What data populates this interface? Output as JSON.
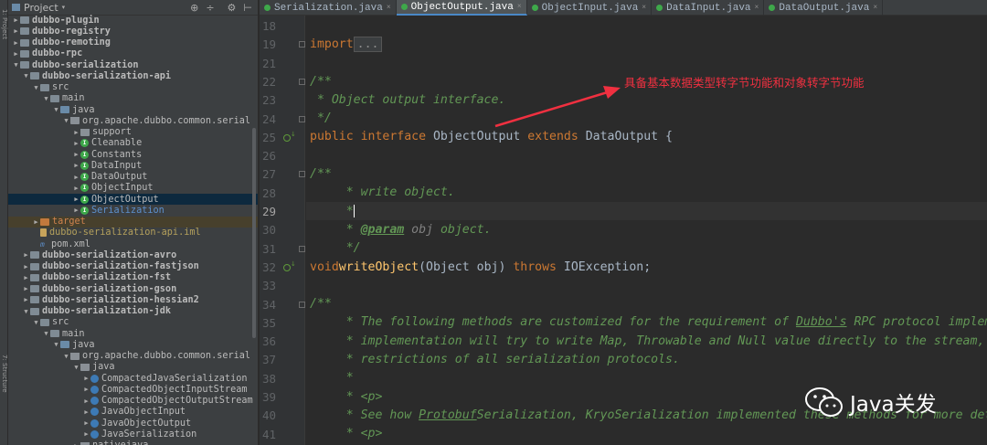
{
  "toolstrip": {
    "project_tab": "1: Project",
    "structure_tab": "7: Structure"
  },
  "project_panel": {
    "title": "Project",
    "tools": [
      "⊕",
      "÷",
      "⚙",
      "⊢"
    ],
    "tree": [
      {
        "label": "dubbo-plugin",
        "depth": 0,
        "arrow": "▶",
        "icon": "folder",
        "style": "bold"
      },
      {
        "label": "dubbo-registry",
        "depth": 0,
        "arrow": "▶",
        "icon": "folder",
        "style": "bold"
      },
      {
        "label": "dubbo-remoting",
        "depth": 0,
        "arrow": "▶",
        "icon": "folder",
        "style": "bold"
      },
      {
        "label": "dubbo-rpc",
        "depth": 0,
        "arrow": "▶",
        "icon": "folder",
        "style": "bold"
      },
      {
        "label": "dubbo-serialization",
        "depth": 0,
        "arrow": "▼",
        "icon": "folder",
        "style": "bold"
      },
      {
        "label": "dubbo-serialization-api",
        "depth": 1,
        "arrow": "▼",
        "icon": "folder",
        "style": "bold"
      },
      {
        "label": "src",
        "depth": 2,
        "arrow": "▼",
        "icon": "folder",
        "style": ""
      },
      {
        "label": "main",
        "depth": 3,
        "arrow": "▼",
        "icon": "folder",
        "style": ""
      },
      {
        "label": "java",
        "depth": 4,
        "arrow": "▼",
        "icon": "src",
        "style": ""
      },
      {
        "label": "org.apache.dubbo.common.serial",
        "depth": 5,
        "arrow": "▼",
        "icon": "pkg",
        "style": ""
      },
      {
        "label": "support",
        "depth": 6,
        "arrow": "▶",
        "icon": "pkg",
        "style": ""
      },
      {
        "label": "Cleanable",
        "depth": 6,
        "arrow": "▶",
        "icon": "cls",
        "style": ""
      },
      {
        "label": "Constants",
        "depth": 6,
        "arrow": "▶",
        "icon": "cls",
        "style": ""
      },
      {
        "label": "DataInput",
        "depth": 6,
        "arrow": "▶",
        "icon": "cls",
        "style": ""
      },
      {
        "label": "DataOutput",
        "depth": 6,
        "arrow": "▶",
        "icon": "cls",
        "style": ""
      },
      {
        "label": "ObjectInput",
        "depth": 6,
        "arrow": "▶",
        "icon": "cls",
        "style": ""
      },
      {
        "label": "ObjectOutput",
        "depth": 6,
        "arrow": "▶",
        "icon": "cls",
        "style": "selected"
      },
      {
        "label": "Serialization",
        "depth": 6,
        "arrow": "▶",
        "icon": "cls",
        "style": "blue"
      },
      {
        "label": "target",
        "depth": 2,
        "arrow": "▶",
        "icon": "orange",
        "style": "orange"
      },
      {
        "label": "dubbo-serialization-api.iml",
        "depth": 2,
        "arrow": "",
        "icon": "file",
        "style": "yel"
      },
      {
        "label": "pom.xml",
        "depth": 2,
        "arrow": "",
        "icon": "m",
        "style": ""
      },
      {
        "label": "dubbo-serialization-avro",
        "depth": 1,
        "arrow": "▶",
        "icon": "folder",
        "style": "bold"
      },
      {
        "label": "dubbo-serialization-fastjson",
        "depth": 1,
        "arrow": "▶",
        "icon": "folder",
        "style": "bold"
      },
      {
        "label": "dubbo-serialization-fst",
        "depth": 1,
        "arrow": "▶",
        "icon": "folder",
        "style": "bold"
      },
      {
        "label": "dubbo-serialization-gson",
        "depth": 1,
        "arrow": "▶",
        "icon": "folder",
        "style": "bold"
      },
      {
        "label": "dubbo-serialization-hessian2",
        "depth": 1,
        "arrow": "▶",
        "icon": "folder",
        "style": "bold"
      },
      {
        "label": "dubbo-serialization-jdk",
        "depth": 1,
        "arrow": "▼",
        "icon": "folder",
        "style": "bold"
      },
      {
        "label": "src",
        "depth": 2,
        "arrow": "▼",
        "icon": "folder",
        "style": ""
      },
      {
        "label": "main",
        "depth": 3,
        "arrow": "▼",
        "icon": "folder",
        "style": ""
      },
      {
        "label": "java",
        "depth": 4,
        "arrow": "▼",
        "icon": "src",
        "style": ""
      },
      {
        "label": "org.apache.dubbo.common.serial",
        "depth": 5,
        "arrow": "▼",
        "icon": "pkg",
        "style": ""
      },
      {
        "label": "java",
        "depth": 6,
        "arrow": "▼",
        "icon": "pkg",
        "style": ""
      },
      {
        "label": "CompactedJavaSerialization",
        "depth": 7,
        "arrow": "▶",
        "icon": "clsb",
        "style": ""
      },
      {
        "label": "CompactedObjectInputStream",
        "depth": 7,
        "arrow": "▶",
        "icon": "clsb",
        "style": ""
      },
      {
        "label": "CompactedObjectOutputStream",
        "depth": 7,
        "arrow": "▶",
        "icon": "clsb",
        "style": ""
      },
      {
        "label": "JavaObjectInput",
        "depth": 7,
        "arrow": "▶",
        "icon": "clsb",
        "style": ""
      },
      {
        "label": "JavaObjectOutput",
        "depth": 7,
        "arrow": "▶",
        "icon": "clsb",
        "style": ""
      },
      {
        "label": "JavaSerialization",
        "depth": 7,
        "arrow": "▶",
        "icon": "clsb",
        "style": ""
      },
      {
        "label": "nativejava",
        "depth": 6,
        "arrow": "▶",
        "icon": "pkg",
        "style": ""
      }
    ]
  },
  "tabs": [
    {
      "label": "Serialization.java",
      "active": false,
      "icon": "g"
    },
    {
      "label": "ObjectOutput.java",
      "active": true,
      "icon": "g"
    },
    {
      "label": "ObjectInput.java",
      "active": false,
      "icon": "g"
    },
    {
      "label": "DataInput.java",
      "active": false,
      "icon": "g"
    },
    {
      "label": "DataOutput.java",
      "active": false,
      "icon": "g"
    }
  ],
  "editor": {
    "current_line": 29,
    "lines": [
      {
        "n": "18",
        "html": ""
      },
      {
        "n": "19",
        "html": "<span class=\"kw\">import</span> <span class=\"fold-box\">...</span>"
      },
      {
        "n": "21",
        "html": ""
      },
      {
        "n": "22",
        "html": "<span class=\"cm\">/**</span>"
      },
      {
        "n": "23",
        "html": "<span class=\"cm\"> * Object output interface.</span>"
      },
      {
        "n": "24",
        "html": "<span class=\"cm\"> */</span>"
      },
      {
        "n": "25",
        "html": "<span class=\"kw\">public interface</span> ObjectOutput <span class=\"kw\">extends</span> DataOutput {"
      },
      {
        "n": "26",
        "html": ""
      },
      {
        "n": "27",
        "html": "    <span class=\"cm\">/**</span>"
      },
      {
        "n": "28",
        "html": "<span class=\"cm\">     * write object.</span>"
      },
      {
        "n": "29",
        "html": "<span class=\"cm\">     *</span><span class=\"caret\"></span>"
      },
      {
        "n": "30",
        "html": "<span class=\"cm\">     * </span><span class=\"tag\">@param</span><span class=\"cm\"> </span><span class=\"cmt\" style=\"font-style:italic\">obj</span><span class=\"cm\"> object.</span>"
      },
      {
        "n": "31",
        "html": "<span class=\"cm\">     */</span>"
      },
      {
        "n": "32",
        "html": "    <span class=\"kw\">void</span> <span class=\"fn\">writeObject</span>(Object obj) <span class=\"kw\">throws</span> IOException;"
      },
      {
        "n": "33",
        "html": ""
      },
      {
        "n": "34",
        "html": "    <span class=\"cm\">/**</span>"
      },
      {
        "n": "35",
        "html": "<span class=\"cm\">     * The following methods are customized for the requirement of </span><span class=\"cm under\">Dubbo's</span><span class=\"cm\"> RPC protocol implementation.</span>"
      },
      {
        "n": "36",
        "html": "<span class=\"cm\">     * implementation will try to write Map, Throwable and Null value directly to the stream, which</span>"
      },
      {
        "n": "37",
        "html": "<span class=\"cm\">     * restrictions of all serialization protocols.</span>"
      },
      {
        "n": "38",
        "html": "<span class=\"cm\">     *</span>"
      },
      {
        "n": "39",
        "html": "<span class=\"cm\">     * &lt;p&gt;</span>"
      },
      {
        "n": "40",
        "html": "<span class=\"cm\">     * See how </span><span class=\"cm under\">Protobuf</span><span class=\"cm\">Serialization, KryoSerialization implemented these methods for more details.</span>"
      },
      {
        "n": "41",
        "html": "<span class=\"cm\">     * &lt;p&gt;</span>"
      }
    ],
    "gutter_markers": [
      {
        "line": "25",
        "type": "implemented"
      },
      {
        "line": "32",
        "type": "implemented"
      }
    ]
  },
  "annotation": {
    "text": "具备基本数据类型转字节功能和对象转字节功能",
    "color": "#f03040"
  },
  "watermark": {
    "text": "Java关发"
  }
}
